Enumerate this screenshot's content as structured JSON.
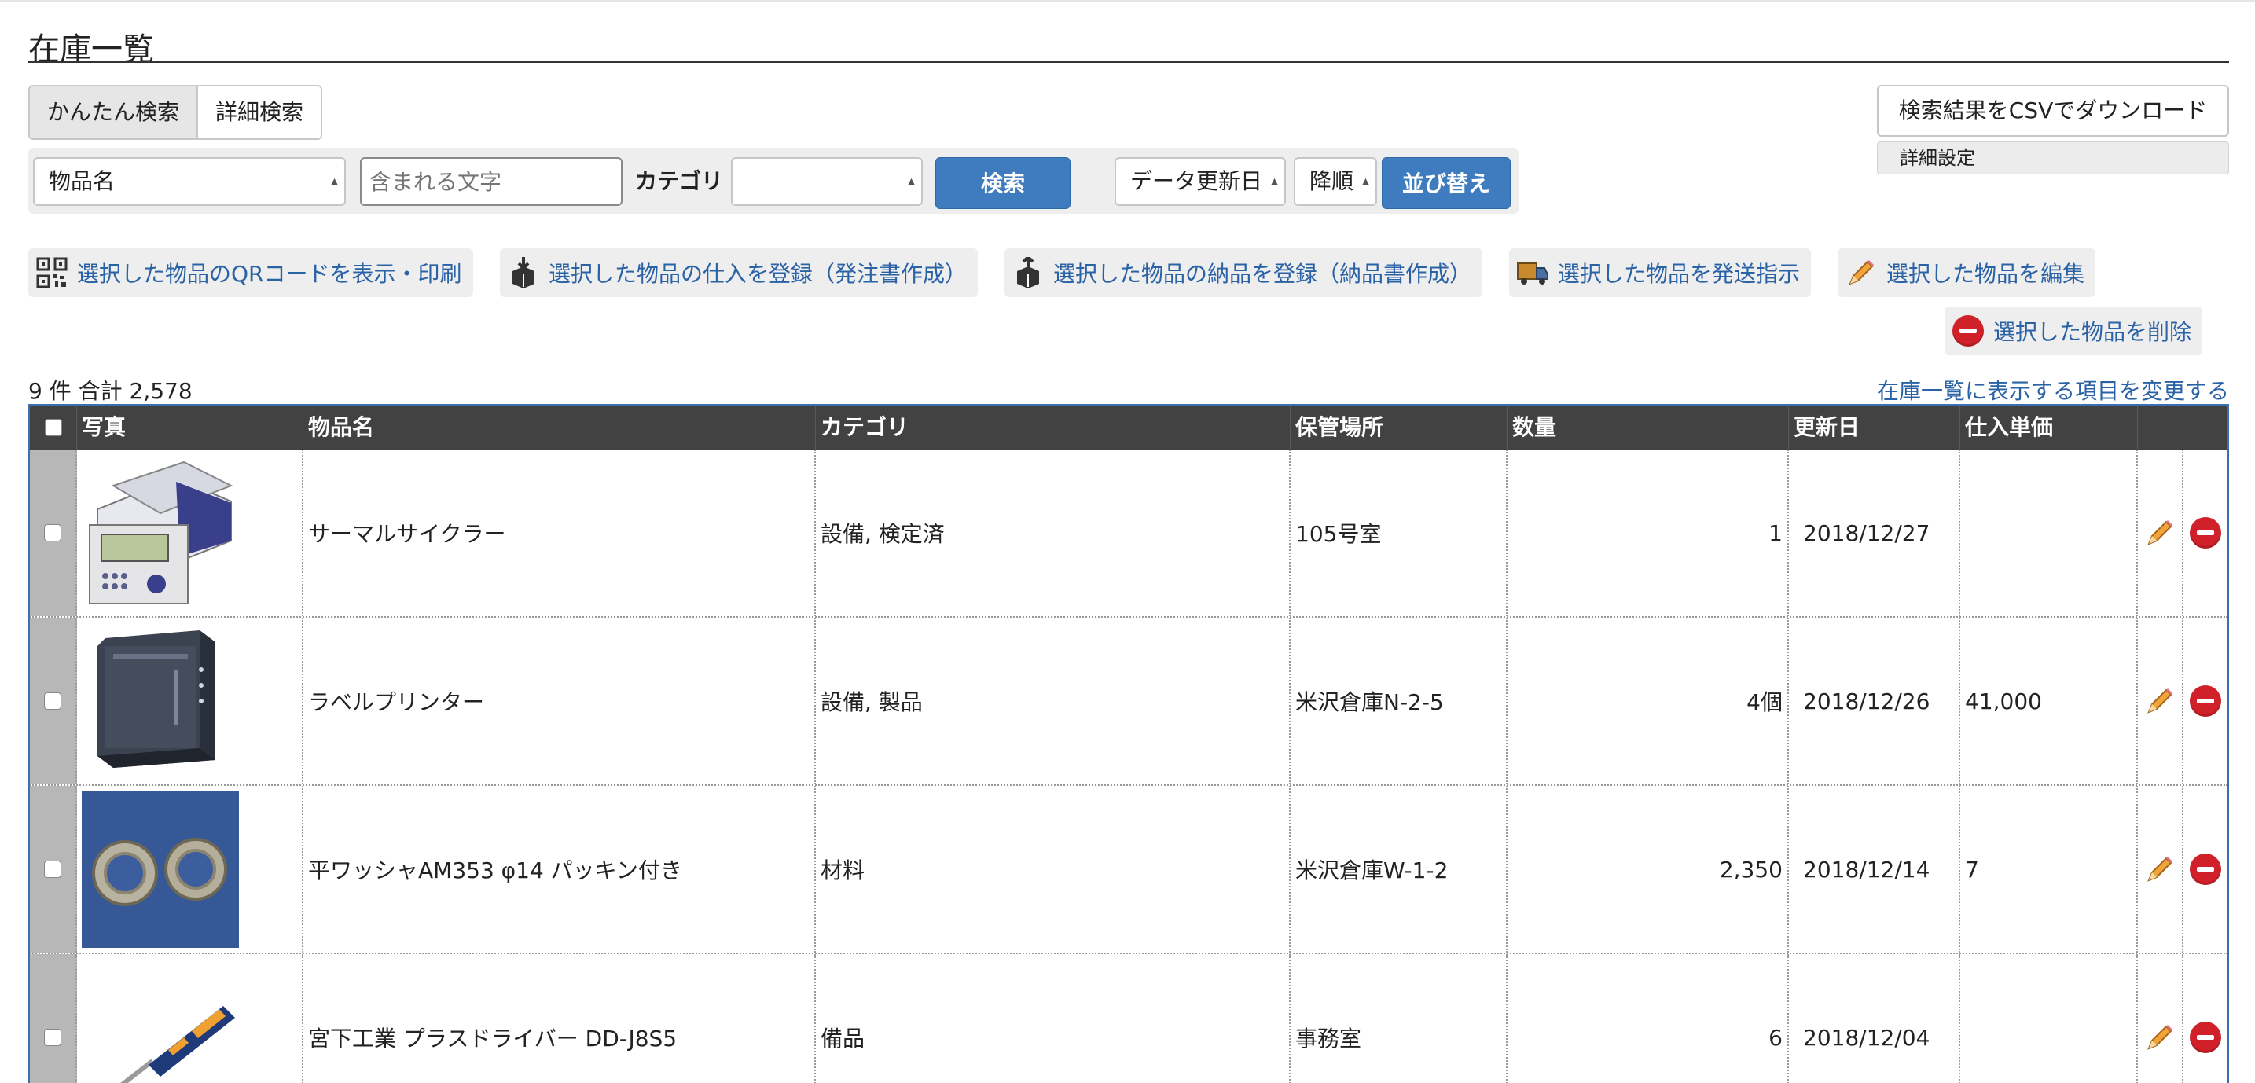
{
  "page": {
    "title": "在庫一覧"
  },
  "tabs": [
    {
      "label": "かんたん検索",
      "active": true
    },
    {
      "label": "詳細検索",
      "active": false
    }
  ],
  "search": {
    "field_select": "物品名",
    "keyword_placeholder": "含まれる文字",
    "category_label": "カテゴリ",
    "category_select": "",
    "search_button": "検索",
    "sort_field": "データ更新日",
    "sort_order": "降順",
    "sort_button": "並び替え"
  },
  "right_actions": {
    "csv_button": "検索結果をCSVでダウンロード",
    "detail_settings": "詳細設定"
  },
  "bulk_actions": [
    {
      "label": "選択した物品のQRコードを表示・印刷",
      "icon": "qr-code-icon"
    },
    {
      "label": "選択した物品の仕入を登録（発注書作成）",
      "icon": "box-in-icon"
    },
    {
      "label": "選択した物品の納品を登録（納品書作成）",
      "icon": "box-out-icon"
    },
    {
      "label": "選択した物品を発送指示",
      "icon": "truck-icon"
    },
    {
      "label": "選択した物品を編集",
      "icon": "pencil-icon"
    },
    {
      "label": "選択した物品を削除",
      "icon": "delete-icon"
    }
  ],
  "summary": {
    "count_text": "9 件 合計 2,578",
    "change_columns_link": "在庫一覧に表示する項目を変更する"
  },
  "table": {
    "columns": [
      "写真",
      "物品名",
      "カテゴリ",
      "保管場所",
      "数量",
      "更新日",
      "仕入単価"
    ],
    "rows": [
      {
        "name": "サーマルサイクラー",
        "category": "設備, 検定済",
        "location": "105号室",
        "quantity": "1",
        "updated": "2018/12/27",
        "unit_price": "",
        "photo": "thermal-cycler"
      },
      {
        "name": "ラベルプリンター",
        "category": "設備, 製品",
        "location": "米沢倉庫N-2-5",
        "quantity": "4個",
        "updated": "2018/12/26",
        "unit_price": "41,000",
        "photo": "label-printer"
      },
      {
        "name": "平ワッシャAM353 φ14 パッキン付き",
        "category": "材料",
        "location": "米沢倉庫W-1-2",
        "quantity": "2,350",
        "updated": "2018/12/14",
        "unit_price": "7",
        "photo": "washers"
      },
      {
        "name": "宮下工業 プラスドライバー DD-J8S5",
        "category": "備品",
        "location": "事務室",
        "quantity": "6",
        "updated": "2018/12/04",
        "unit_price": "",
        "photo": "screwdriver"
      }
    ]
  },
  "colors": {
    "accent_blue": "#3f7bbf",
    "link_blue": "#2a62a6",
    "header_dark": "#424242",
    "delete_red": "#d0212b"
  }
}
